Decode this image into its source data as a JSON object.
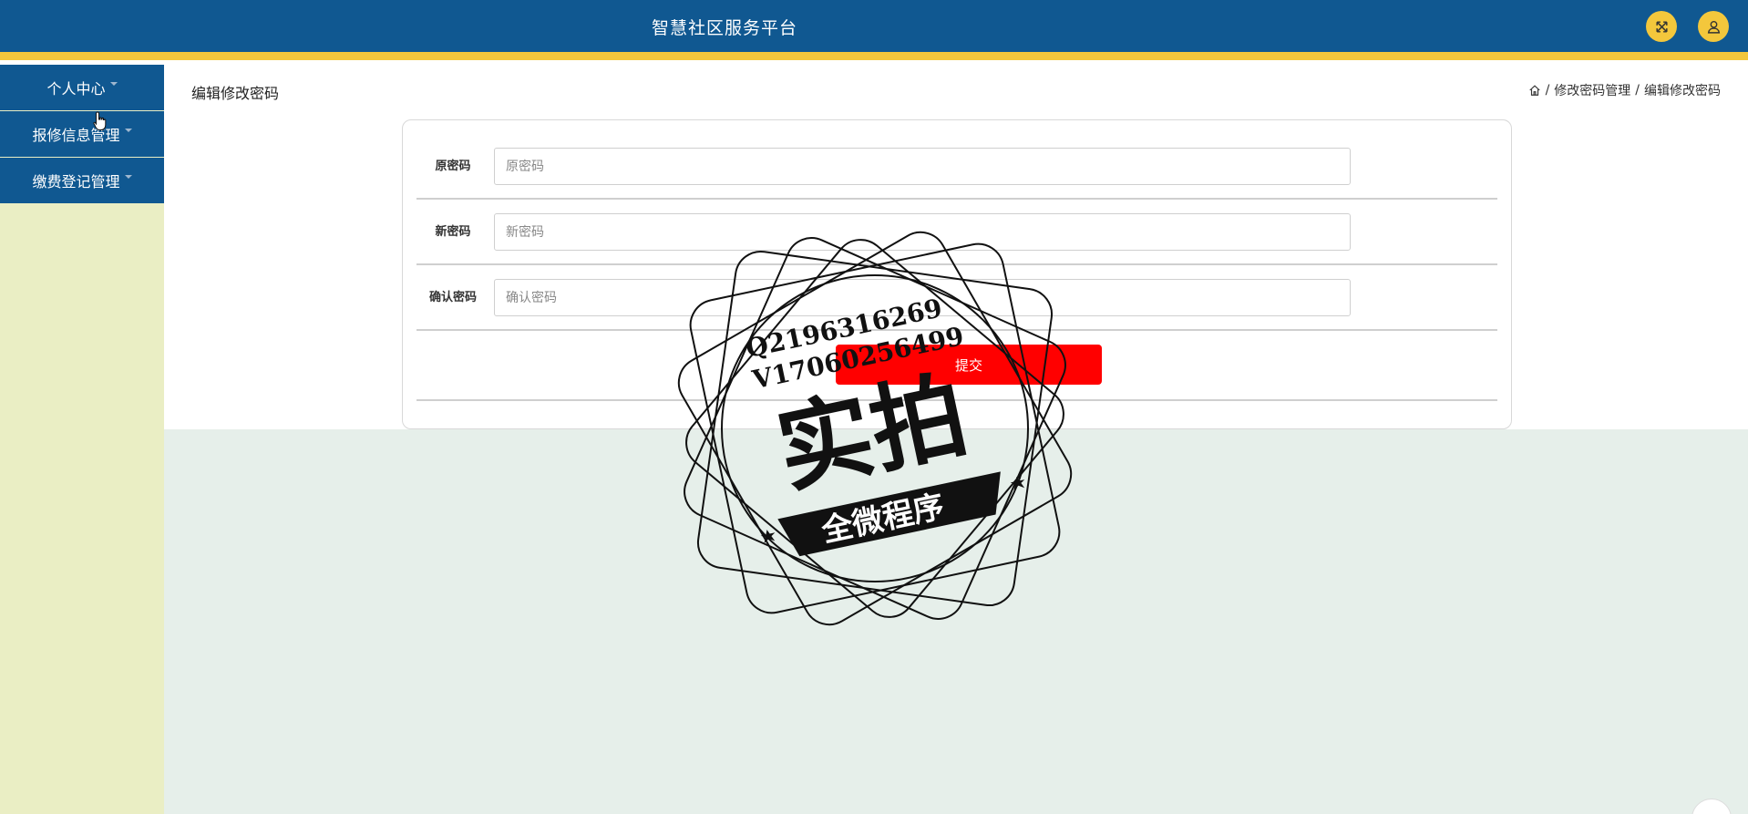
{
  "header": {
    "title": "智慧社区服务平台",
    "icons": [
      "expand-icon",
      "user-icon"
    ]
  },
  "sidebar": {
    "items": [
      {
        "label": "个人中心"
      },
      {
        "label": "报修信息管理"
      },
      {
        "label": "缴费登记管理"
      }
    ]
  },
  "main": {
    "page_title": "编辑修改密码",
    "breadcrumb": {
      "home_icon": "home-icon",
      "separator": "/",
      "items": [
        "修改密码管理",
        "编辑修改密码"
      ]
    }
  },
  "form": {
    "fields": [
      {
        "label": "原密码",
        "placeholder": "原密码",
        "value": ""
      },
      {
        "label": "新密码",
        "placeholder": "新密码",
        "value": ""
      },
      {
        "label": "确认密码",
        "placeholder": "确认密码",
        "value": ""
      }
    ],
    "submit_label": "提交"
  },
  "watermark": {
    "line1": "Q2196316269",
    "line2": "V17060256499",
    "main": "实拍",
    "banner": "全微程序"
  },
  "colors": {
    "header_bg": "#105891",
    "accent_stripe": "#f3c73c",
    "sidebar_bg": "#eaeec4",
    "main_bg": "#e6efea",
    "submit_bg": "#ff0000"
  }
}
